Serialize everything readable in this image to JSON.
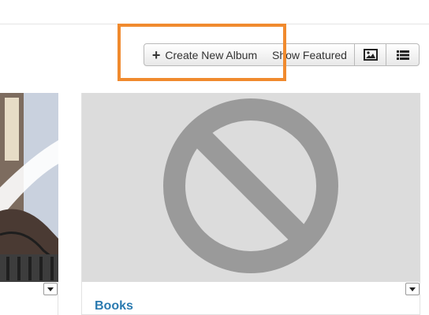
{
  "toolbar": {
    "create_label": "Create New Album",
    "featured_label": "Show Featured"
  },
  "icons": {
    "create": "plus-icon",
    "grid": "image-icon",
    "list": "list-icon",
    "disabled": "no-image-icon"
  },
  "colors": {
    "highlight": "#f08a2e",
    "title": "#2a7ab0",
    "placeholder_bg": "#dcdcdc"
  },
  "albums": [
    {
      "title": ""
    },
    {
      "title": "Books"
    }
  ]
}
